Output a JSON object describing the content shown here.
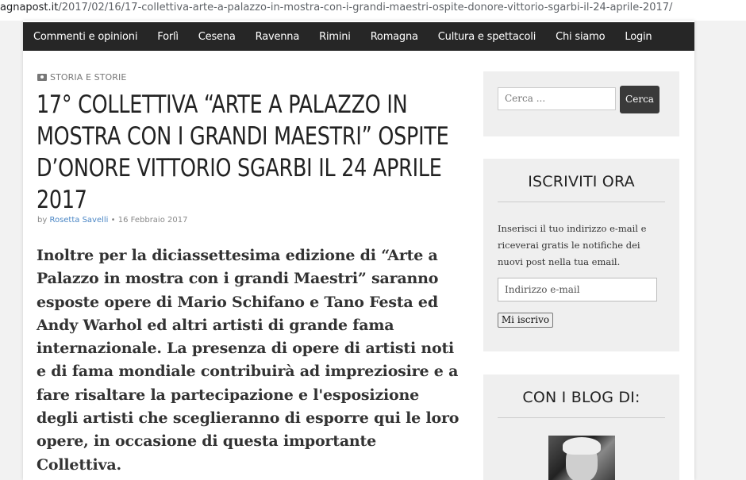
{
  "browser": {
    "url_host": "agnapost.it",
    "url_path": "/2017/02/16/17-collettiva-arte-a-palazzo-in-mostra-con-i-grandi-maestri-ospite-donore-vittorio-sgarbi-il-24-aprile-2017/"
  },
  "nav": {
    "items": [
      "Commenti e opinioni",
      "Forlì",
      "Cesena",
      "Ravenna",
      "Rimini",
      "Romagna",
      "Cultura e spettacoli",
      "Chi siamo",
      "Login"
    ]
  },
  "article": {
    "category": "STORIA E STORIE",
    "title": "17° COLLETTIVA “ARTE A PALAZZO IN MOSTRA CON I GRANDI MAESTRI” OSPITE D’ONORE VITTORIO SGARBI IL 24 APRILE 2017",
    "meta_by": "by ",
    "author": "Rosetta Savelli",
    "meta_sep": " • ",
    "date": "16 Febbraio 2017",
    "body": "Inoltre per la diciassettesima edizione di “Arte a Palazzo in mostra con i grandi Maestri” saranno esposte opere di Mario Schifano e Tano Festa ed Andy Warhol ed altri artisti di grande fama internazionale. La presenza di opere di artisti noti e di fama mondiale contribuirà ad impreziosire e a fare risaltare la partecipazione e l'esposizione degli artisti che sceglieranno di esporre qui le loro opere, in occasione di questa importante Collettiva."
  },
  "sidebar": {
    "search": {
      "placeholder": "Cerca ...",
      "button": "Cerca"
    },
    "subscribe": {
      "title": "ISCRIVITI ORA",
      "description": "Inserisci il tuo indirizzo e-mail e riceverai gratis le notifiche dei nuovi post nella tua email.",
      "email_placeholder": "Indirizzo e-mail",
      "button": "Mi iscrivo"
    },
    "blogs": {
      "title": "CON I BLOG DI:"
    }
  }
}
